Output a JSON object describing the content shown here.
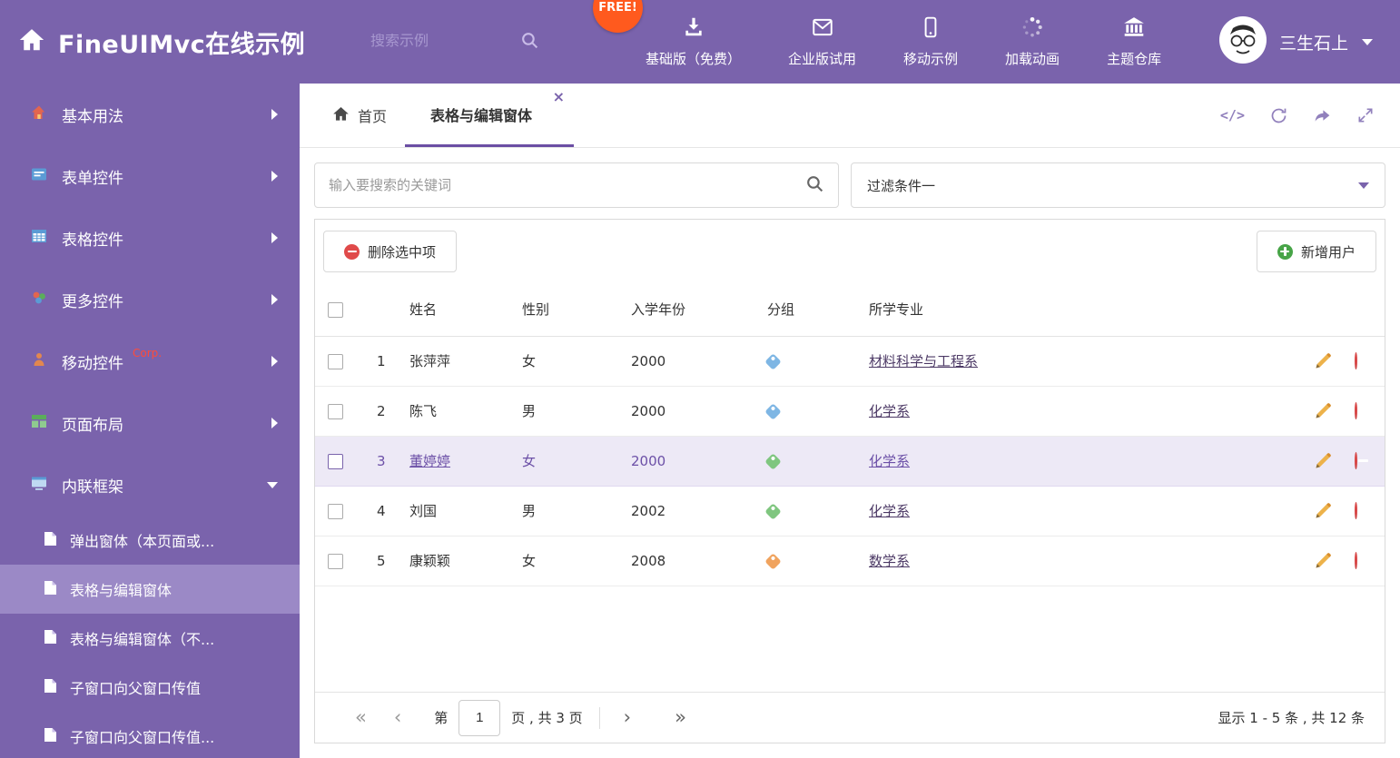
{
  "colors": {
    "theme_purple": "#7A63AC",
    "active_item_purple": "#9B89C6",
    "accent_purple": "#6B4EA4",
    "free_badge_orange": "#FF5A1E",
    "tag_blue": "#7EB6E4",
    "tag_green": "#7FC67F",
    "tag_orange": "#F0A35E",
    "delete_red": "#E04A4A",
    "add_green": "#47A447"
  },
  "header": {
    "title": "FineUIMvc在线示例",
    "search_placeholder": "搜索示例",
    "free_badge": "FREE!",
    "nav": [
      {
        "label": "基础版（免费）",
        "icon": "download-icon"
      },
      {
        "label": "企业版试用",
        "icon": "envelope-icon"
      },
      {
        "label": "移动示例",
        "icon": "mobile-icon"
      },
      {
        "label": "加载动画",
        "icon": "spinner-icon"
      },
      {
        "label": "主题仓库",
        "icon": "bank-icon"
      }
    ],
    "user_name": "三生石上"
  },
  "sidebar": {
    "items": [
      {
        "label": "基本用法",
        "icon": "house-icon"
      },
      {
        "label": "表单控件",
        "icon": "form-icon"
      },
      {
        "label": "表格控件",
        "icon": "table-icon"
      },
      {
        "label": "更多控件",
        "icon": "widgets-icon"
      },
      {
        "label": "移动控件",
        "badge": "Corp.",
        "icon": "person-icon"
      },
      {
        "label": "页面布局",
        "icon": "layout-icon"
      },
      {
        "label": "内联框架",
        "icon": "frame-icon"
      }
    ],
    "subitems": [
      {
        "label": "弹出窗体（本页面或..."
      },
      {
        "label": "表格与编辑窗体"
      },
      {
        "label": "表格与编辑窗体（不..."
      },
      {
        "label": "子窗口向父窗口传值"
      },
      {
        "label": "子窗口向父窗口传值..."
      }
    ]
  },
  "tabs": {
    "home": "首页",
    "active": "表格与编辑窗体"
  },
  "filters": {
    "search_placeholder": "输入要搜索的关键词",
    "dropdown_value": "过滤条件一"
  },
  "toolbar": {
    "delete_label": "删除选中项",
    "add_label": "新增用户"
  },
  "table": {
    "headers": {
      "name": "姓名",
      "gender": "性别",
      "year": "入学年份",
      "group": "分组",
      "major": "所学专业"
    },
    "rows": [
      {
        "num": "1",
        "name": "张萍萍",
        "gender": "女",
        "year": "2000",
        "tag_color": "#7EB6E4",
        "major": "材料科学与工程系",
        "selected": false
      },
      {
        "num": "2",
        "name": "陈飞",
        "gender": "男",
        "year": "2000",
        "tag_color": "#7EB6E4",
        "major": "化学系",
        "selected": false
      },
      {
        "num": "3",
        "name": "董婷婷",
        "gender": "女",
        "year": "2000",
        "tag_color": "#7FC67F",
        "major": "化学系",
        "selected": true
      },
      {
        "num": "4",
        "name": "刘国",
        "gender": "男",
        "year": "2002",
        "tag_color": "#7FC67F",
        "major": "化学系",
        "selected": false
      },
      {
        "num": "5",
        "name": "康颖颖",
        "gender": "女",
        "year": "2008",
        "tag_color": "#F0A35E",
        "major": "数学系",
        "selected": false
      }
    ]
  },
  "pagination": {
    "prefix": "第",
    "current_page": "1",
    "suffix": "页 , 共 3 页",
    "summary": "显示 1 - 5 条 , 共 12 条"
  }
}
